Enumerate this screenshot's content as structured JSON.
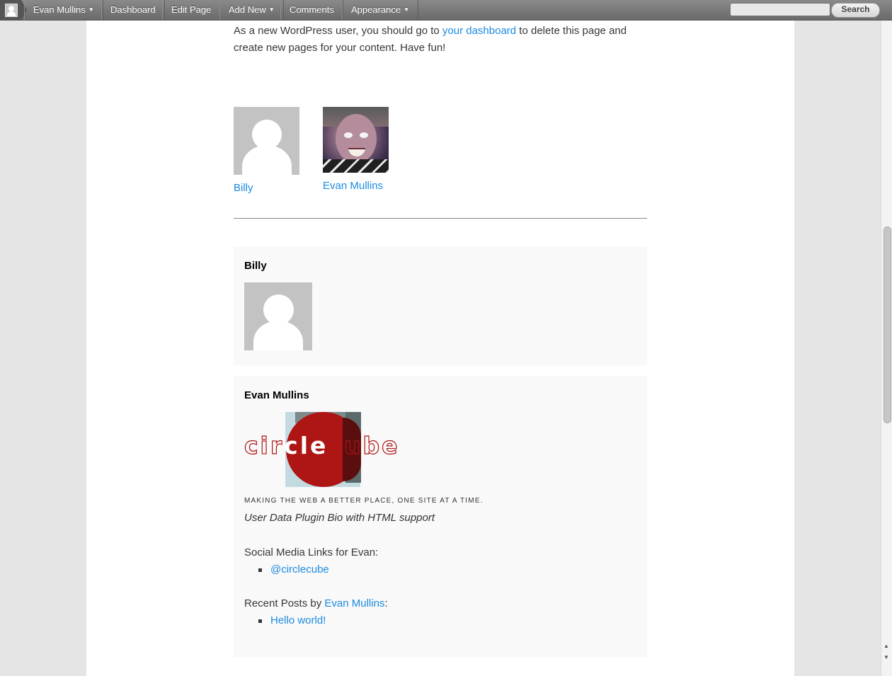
{
  "admin_bar": {
    "user_name": "Evan Mullins",
    "items": [
      "Dashboard",
      "Edit Page",
      "Add New",
      "Comments",
      "Appearance"
    ],
    "search_button": "Search",
    "search_placeholder": ""
  },
  "intro": {
    "before_link": "As a new WordPress user, you should go to ",
    "link": "your dashboard",
    "after_link": " to delete this page and create new pages for your content. Have fun!"
  },
  "authors": [
    {
      "name": "Billy",
      "avatar": "default-avatar"
    },
    {
      "name": "Evan Mullins",
      "avatar": "photo-avatar"
    }
  ],
  "cards": {
    "billy": {
      "name": "Billy"
    },
    "evan": {
      "name": "Evan Mullins",
      "logo_text": [
        "cir",
        "cle",
        "c",
        "ube"
      ],
      "tagline": "MAKING THE WEB A BETTER PLACE, ONE SITE AT A TIME.",
      "bio": "User Data Plugin Bio with HTML support",
      "social_label": "Social Media Links for Evan:",
      "social_links": [
        "@circlecube"
      ],
      "recent_label_prefix": "Recent Posts by ",
      "recent_author_link": "Evan Mullins",
      "recent_label_suffix": ":",
      "recent_posts": [
        "Hello world!"
      ]
    }
  },
  "colors": {
    "link": "#1b8be0",
    "logo_red": "#ae1515"
  }
}
